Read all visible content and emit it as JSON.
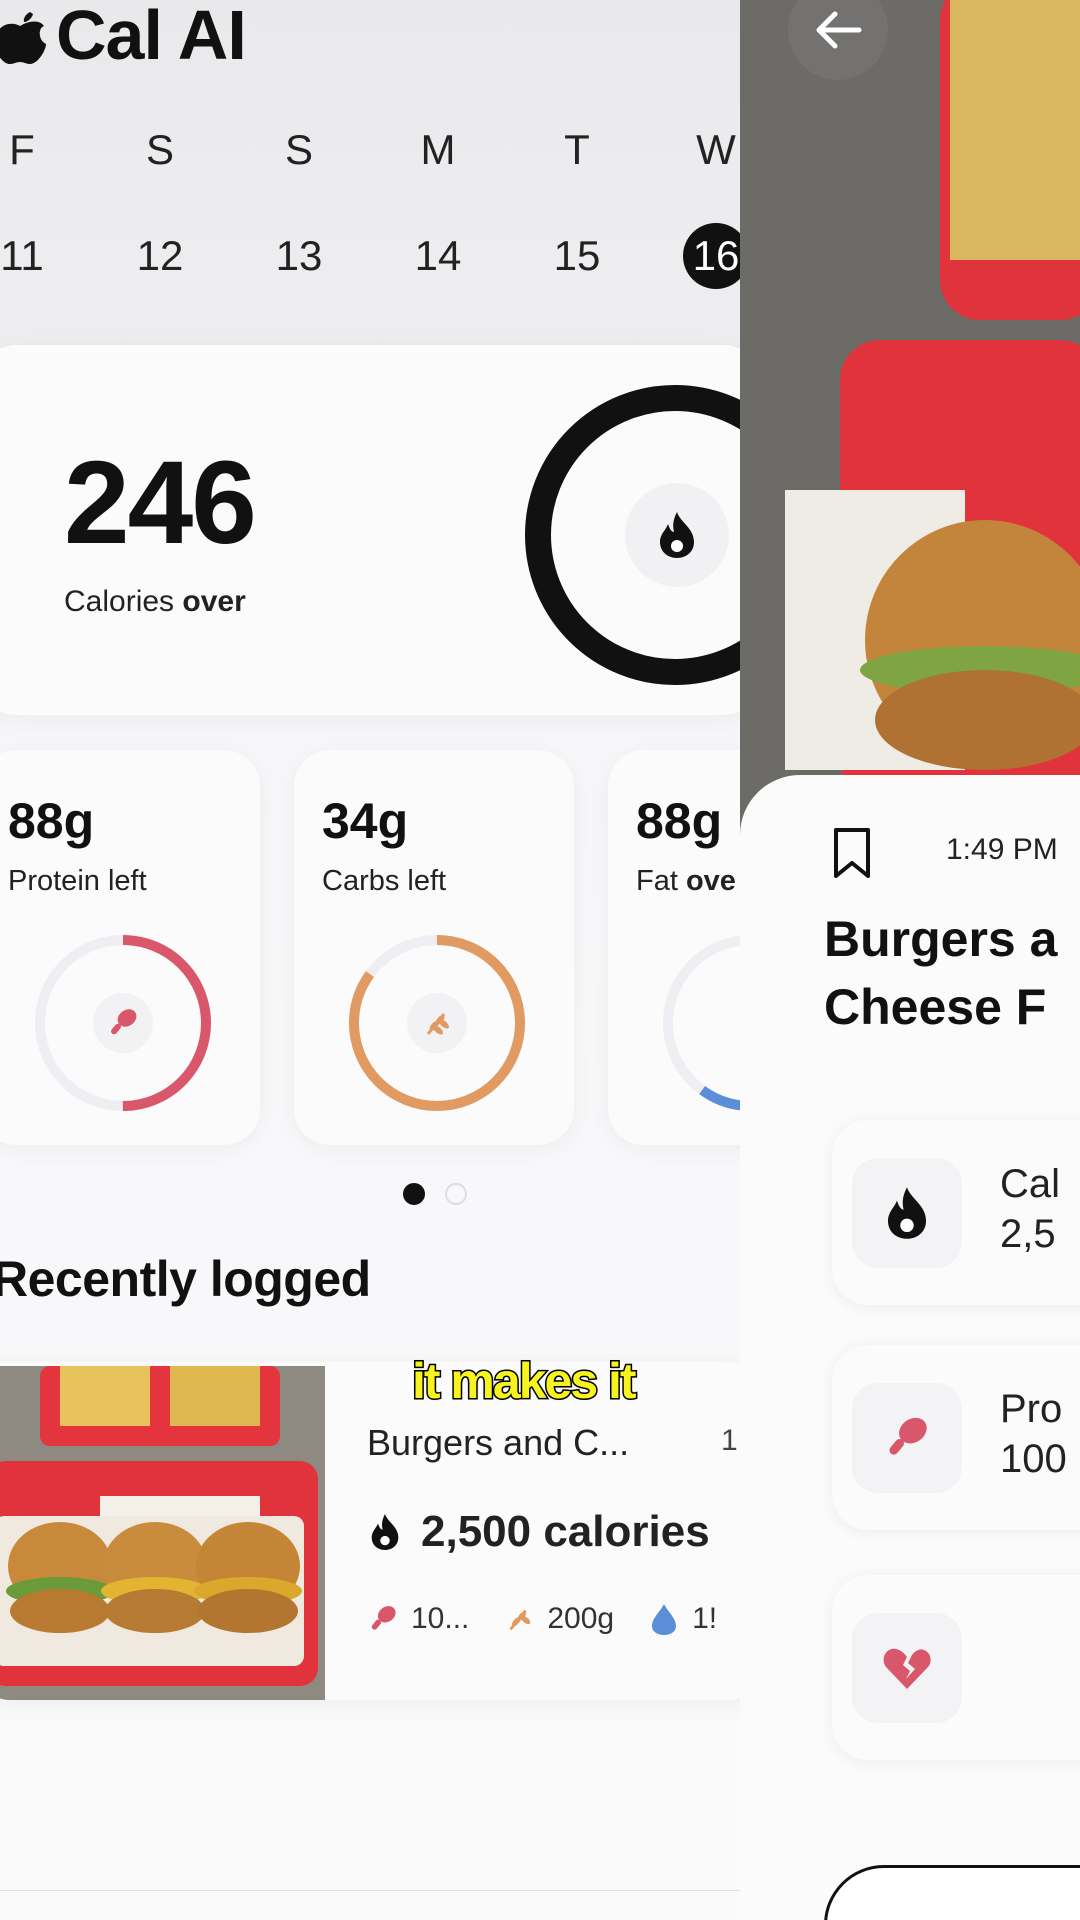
{
  "app": {
    "name": "Cal AI"
  },
  "week": [
    {
      "letter": "F",
      "num": "11"
    },
    {
      "letter": "S",
      "num": "12"
    },
    {
      "letter": "S",
      "num": "13"
    },
    {
      "letter": "M",
      "num": "14"
    },
    {
      "letter": "T",
      "num": "15"
    },
    {
      "letter": "W",
      "num": "16",
      "selected": true
    }
  ],
  "calories": {
    "value": "246",
    "label": "Calories",
    "label_bold": "over"
  },
  "macros": [
    {
      "value": "88g",
      "label": "Protein left",
      "label_bold": "",
      "color": "#d9576a",
      "progress": 0.5,
      "icon": "drumstick-icon"
    },
    {
      "value": "34g",
      "label": "Carbs left",
      "label_bold": "",
      "color": "#e09a62",
      "progress": 0.85,
      "icon": "wheat-icon"
    },
    {
      "value": "88g",
      "label": "Fat",
      "label_bold": "ove",
      "color": "#5a8fd8",
      "progress": 0.6,
      "icon": "water-drop-icon"
    }
  ],
  "recent": {
    "title": "Recently logged",
    "item": {
      "name": "Burgers and C...",
      "time": "1:",
      "calories": "2,500 calories",
      "protein": "10...",
      "carbs": "200g",
      "fat": "1!"
    }
  },
  "caption": "it makes it",
  "detail": {
    "time": "1:49 PM",
    "title_line1": "Burgers a",
    "title_line2": "Cheese F",
    "nutrients": [
      {
        "label": "Cal",
        "value": "2,5",
        "icon": "flame-icon"
      },
      {
        "label": "Pro",
        "value": "100",
        "icon": "drumstick-icon"
      },
      {
        "label": "",
        "value": "",
        "icon": "broken-heart-icon"
      }
    ]
  },
  "colors": {
    "protein": "#d9576a",
    "carbs": "#e09a62",
    "fat": "#5a8fd8",
    "dark": "#111111",
    "caption": "#f6f31f"
  }
}
